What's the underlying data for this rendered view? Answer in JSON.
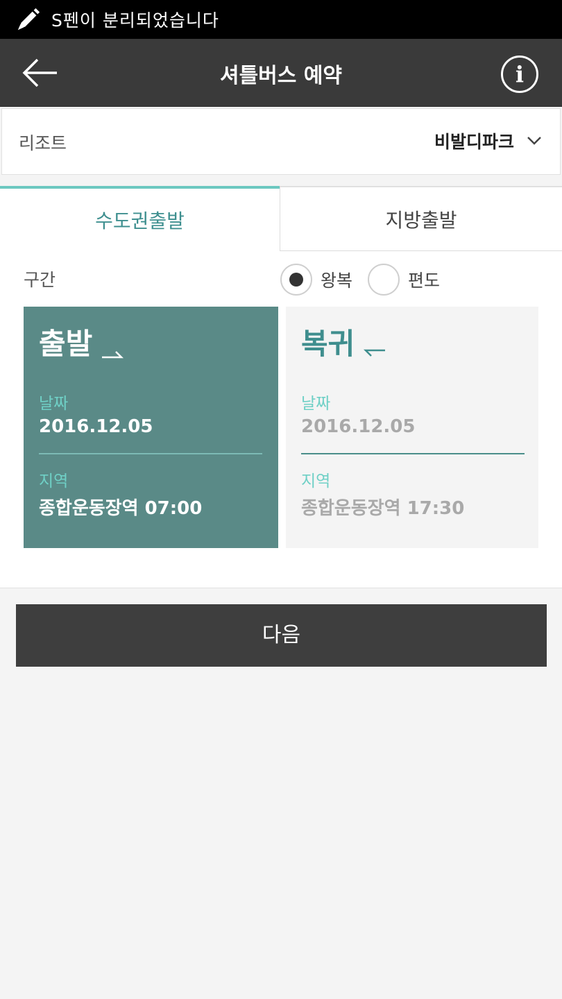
{
  "status_bar": {
    "text": "S펜이 분리되었습니다",
    "icon": "pen-icon"
  },
  "header": {
    "title": "셔틀버스 예약",
    "back_icon": "back-arrow-icon",
    "info_icon": "info-icon",
    "info_glyph": "i"
  },
  "resort": {
    "label": "리조트",
    "value": "비발디파크",
    "icon": "chevron-down-icon"
  },
  "tabs": [
    {
      "label": "수도권출발",
      "active": true
    },
    {
      "label": "지방출발",
      "active": false
    }
  ],
  "route": {
    "label": "구간",
    "options": [
      {
        "label": "왕복",
        "selected": true
      },
      {
        "label": "편도",
        "selected": false
      }
    ]
  },
  "departure": {
    "title": "출발",
    "date_label": "날짜",
    "date": "2016.12.05",
    "area_label": "지역",
    "area": "종합운동장역 07:00"
  },
  "return": {
    "title": "복귀",
    "date_label": "날짜",
    "date": "2016.12.05",
    "area_label": "지역",
    "area": "종합운동장역 17:30"
  },
  "next_button": {
    "label": "다음"
  },
  "colors": {
    "accent": "#6cc8c0",
    "teal": "#3f8e8e",
    "card_active": "#5a8a87",
    "header": "#3a3a3a",
    "button": "#3e3e3e"
  }
}
